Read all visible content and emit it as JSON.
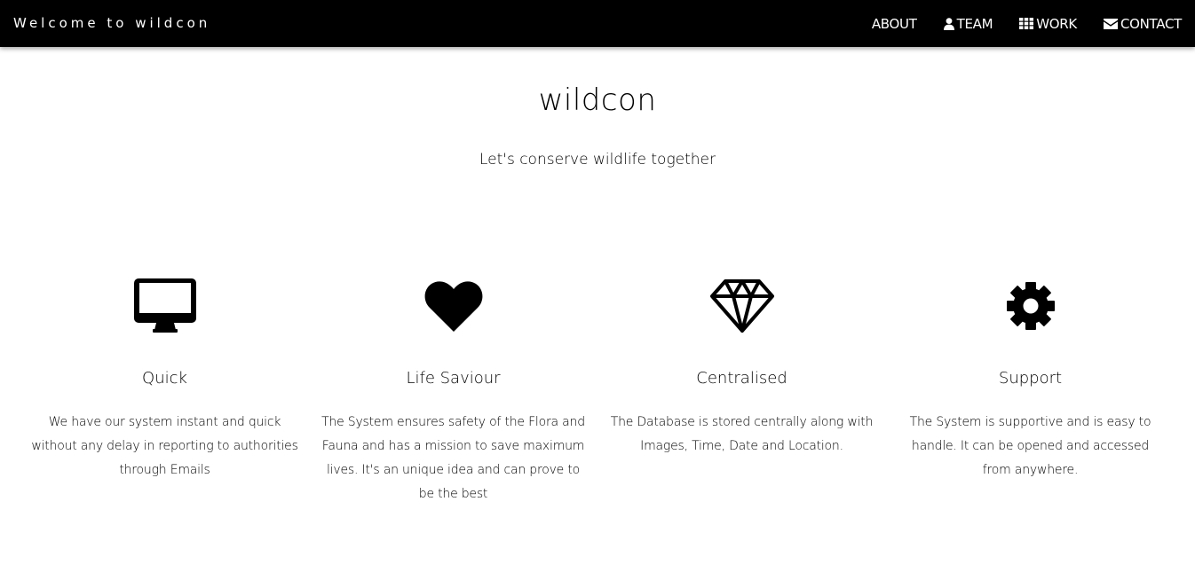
{
  "navbar": {
    "brand": "Welcome to wildcon",
    "links": [
      {
        "label": "ABOUT",
        "icon": ""
      },
      {
        "label": "TEAM",
        "icon": "user-icon"
      },
      {
        "label": "WORK",
        "icon": "grid-icon"
      },
      {
        "label": "CONTACT",
        "icon": "envelope-icon"
      }
    ]
  },
  "hero": {
    "title": "wildcon",
    "tagline": "Let's conserve wildlife together"
  },
  "features": [
    {
      "icon": "desktop-icon",
      "title": "Quick",
      "text": "We have our system instant and quick without any delay in reporting to authorities through Emails"
    },
    {
      "icon": "heart-icon",
      "title": "Life Saviour",
      "text": "The System ensures safety of the Flora and Fauna and has a mission to save maximum lives. It's an unique idea and can prove to be the best"
    },
    {
      "icon": "diamond-icon",
      "title": "Centralised",
      "text": "The Database is stored centrally along with Images, Time, Date and Location."
    },
    {
      "icon": "gear-icon",
      "title": "Support",
      "text": "The System is supportive and is easy to handle. It can be opened and accessed from anywhere."
    }
  ],
  "colors": {
    "navbar_bg": "#000000",
    "navbar_text": "#ffffff",
    "page_bg": "#ffffff",
    "text": "#000000"
  }
}
